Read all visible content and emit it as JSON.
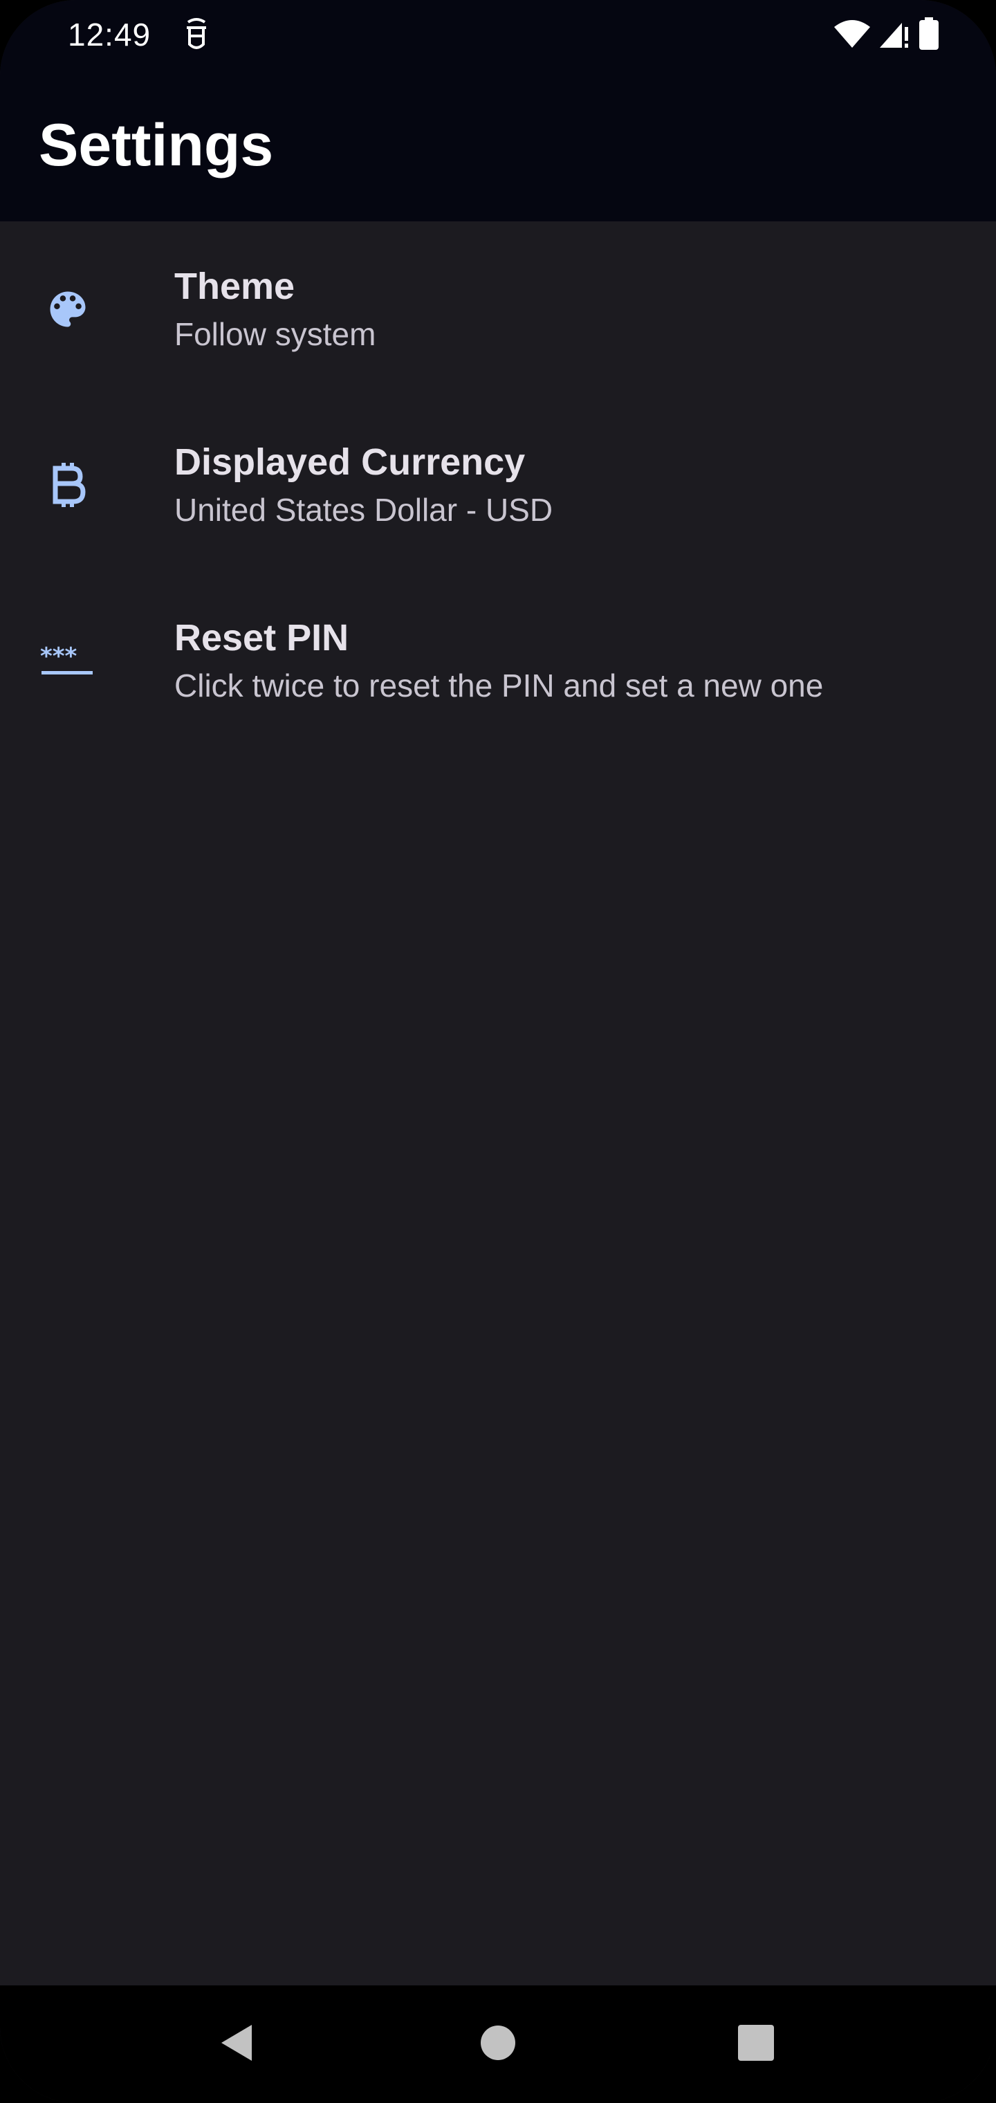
{
  "status_bar": {
    "time": "12:49",
    "icons": [
      "notification-icon",
      "wifi-icon",
      "cellular-icon",
      "battery-icon"
    ]
  },
  "header": {
    "title": "Settings"
  },
  "settings": {
    "items": [
      {
        "icon": "palette-icon",
        "title": "Theme",
        "subtitle": "Follow system"
      },
      {
        "icon": "bitcoin-icon",
        "title": "Displayed Currency",
        "subtitle": "United States Dollar - USD"
      },
      {
        "icon": "password-icon",
        "title": "Reset PIN",
        "subtitle": "Click twice to reset the PIN and set a new one"
      }
    ]
  },
  "navigation": {
    "buttons": [
      "back-icon",
      "home-icon",
      "recents-icon"
    ]
  },
  "colors": {
    "accent": "#a8c7fa",
    "header_background": "#050611",
    "body_background": "#1c1b20"
  }
}
